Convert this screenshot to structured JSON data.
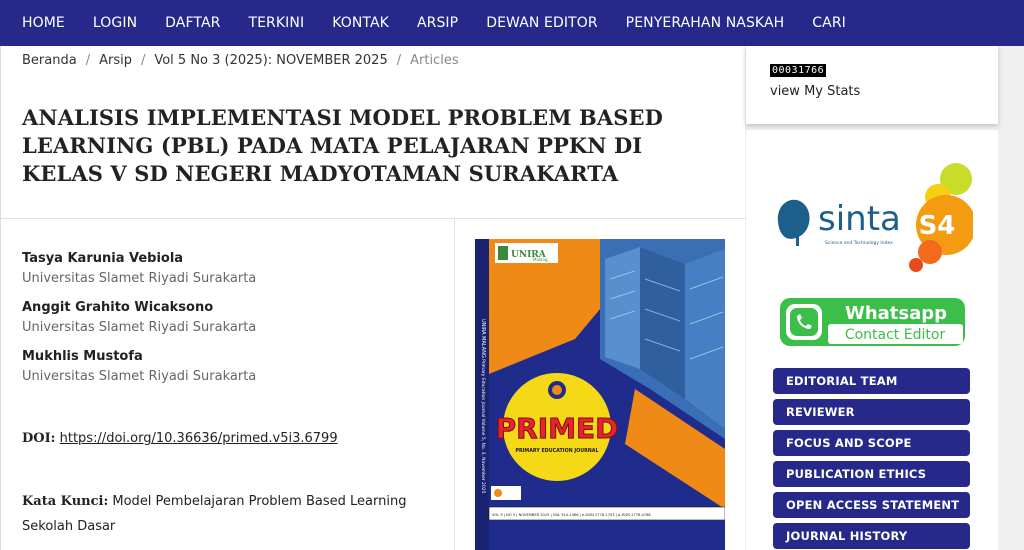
{
  "nav": {
    "items": [
      "HOME",
      "LOGIN",
      "DAFTAR",
      "TERKINI",
      "KONTAK",
      "ARSIP",
      "DEWAN EDITOR",
      "PENYERAHAN NASKAH",
      "CARI"
    ]
  },
  "breadcrumb": {
    "home": "Beranda",
    "archive": "Arsip",
    "issue": "Vol 5 No 3 (2025): NOVEMBER 2025",
    "current": "Articles"
  },
  "article": {
    "title": "ANALISIS IMPLEMENTASI MODEL PROBLEM BASED LEARNING (PBL) PADA MATA PELAJARAN PPKN DI KELAS V SD NEGERI MADYOTAMAN SURAKARTA",
    "authors": [
      {
        "name": "Tasya Karunia Vebiola",
        "affiliation": "Universitas Slamet Riyadi Surakarta"
      },
      {
        "name": "Anggit Grahito Wicaksono",
        "affiliation": "Universitas Slamet Riyadi Surakarta"
      },
      {
        "name": "Mukhlis Mustofa",
        "affiliation": "Universitas Slamet Riyadi Surakarta"
      }
    ],
    "doi_label": "DOI:",
    "doi_url": "https://doi.org/10.36636/primed.v5i3.6799",
    "keywords_label": "Kata Kunci:",
    "keywords": [
      "Model Pembelajaran Problem Based Learning",
      "Sekolah Dasar"
    ]
  },
  "cover": {
    "publisher": "UNIRA",
    "publisher_sub": "Malang",
    "journal": "PRIMED",
    "journal_sub": "PRIMARY EDUCATION JOURNAL",
    "spine_text": "UNIRA MALANG",
    "side_text": "Primary Education Journal Volume 5, No. 3, November 2025",
    "info_strip": "VOL 5 | NO 3 | NOVEMBER 2025 | HAL 914-1366 | e-ISSN 2776-1703 | p-ISSN 2776-4788",
    "colors": {
      "navy": "#1f2c8c",
      "orange": "#f08a17",
      "yellow": "#f5d916",
      "red": "#e8232b"
    }
  },
  "sidebar": {
    "counter": "00031766",
    "view_stats": "view My Stats",
    "sinta_logo_text": "sinta",
    "sinta_grade": "S4",
    "sinta_tagline": "Science and Technology Index",
    "whatsapp_title": "Whatsapp",
    "whatsapp_sub": "Contact Editor",
    "buttons": [
      "EDITORIAL TEAM",
      "REVIEWER",
      "FOCUS AND SCOPE",
      "PUBLICATION ETHICS",
      "OPEN ACCESS STATEMENT",
      "JOURNAL HISTORY"
    ]
  },
  "theme": {
    "nav_bg": "#26298a",
    "button_bg": "#26298a",
    "whatsapp_green": "#3cbf4a"
  }
}
